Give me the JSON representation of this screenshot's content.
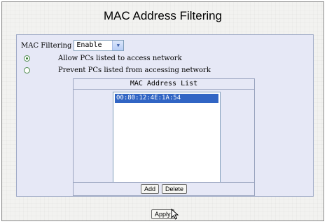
{
  "page": {
    "title": "MAC Address Filtering"
  },
  "filter": {
    "label": "MAC Filtering",
    "selected": "Enable",
    "arrow_icon": "chevron-down-icon"
  },
  "options": [
    {
      "label": "Allow PCs listed to access network",
      "checked": true
    },
    {
      "label": "Prevent PCs listed from accessing network",
      "checked": false
    }
  ],
  "mac_list": {
    "title": "MAC Address List",
    "items": [
      "00:80:12:4E:1A:54"
    ],
    "add_label": "Add",
    "delete_label": "Delete"
  },
  "apply_label": "Apply",
  "colors": {
    "panel_bg": "#e6e8f6",
    "selection": "#3165c4",
    "border": "#9aa4bf"
  }
}
